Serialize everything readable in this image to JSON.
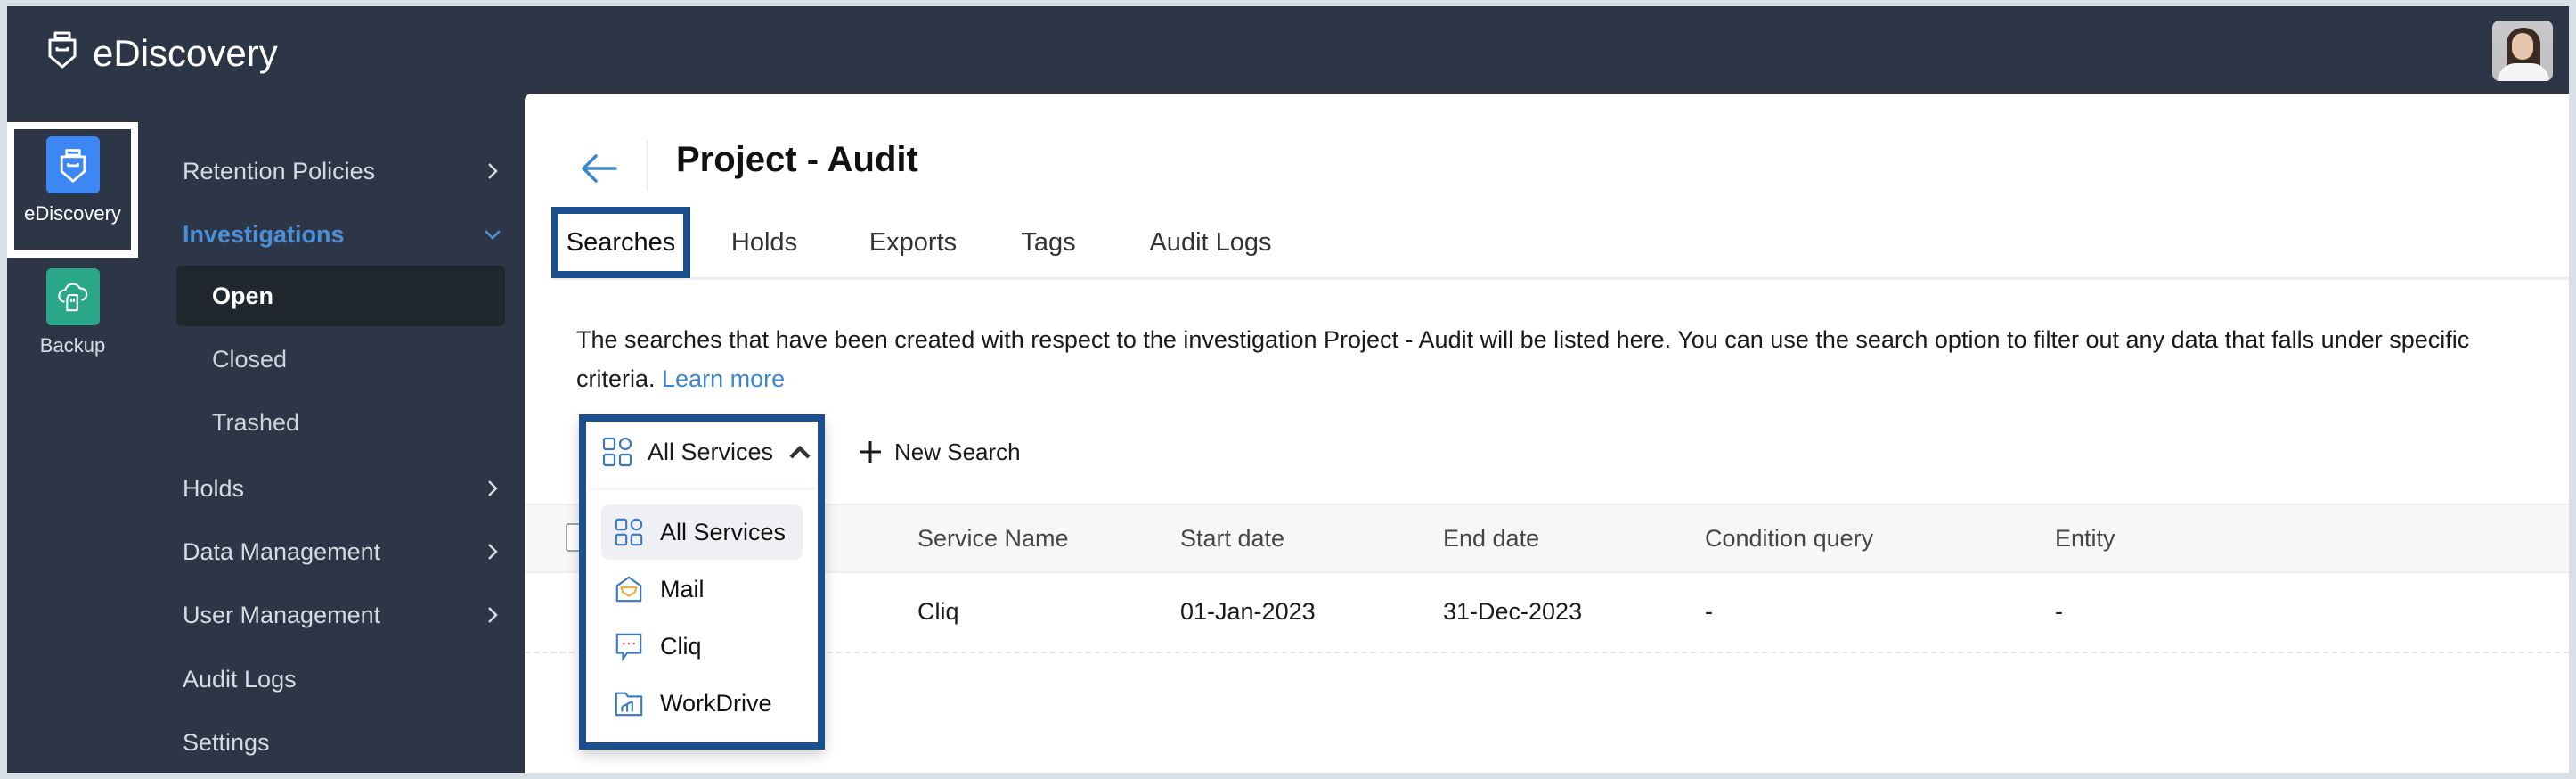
{
  "header": {
    "app_title": "eDiscovery",
    "logo_icon": "ediscovery-shield-icon",
    "avatar_alt": "user-avatar"
  },
  "app_switcher": [
    {
      "label": "eDiscovery",
      "icon": "ediscovery-shield-icon",
      "color": "#3d87f5",
      "selected": true
    },
    {
      "label": "Backup",
      "icon": "cloud-backup-icon",
      "color": "#2aa789",
      "selected": false
    }
  ],
  "nav": {
    "items": [
      {
        "label": "Retention Policies",
        "chevron": "right"
      },
      {
        "label": "Investigations",
        "chevron": "down",
        "active": true
      },
      {
        "label": "Holds",
        "chevron": "right"
      },
      {
        "label": "Data Management",
        "chevron": "right"
      },
      {
        "label": "User Management",
        "chevron": "right"
      },
      {
        "label": "Audit Logs"
      },
      {
        "label": "Settings"
      }
    ],
    "sub_items": [
      {
        "label": "Open",
        "selected": true
      },
      {
        "label": "Closed"
      },
      {
        "label": "Trashed"
      }
    ]
  },
  "page": {
    "title": "Project - Audit",
    "back_icon": "arrow-left-icon",
    "tabs": [
      {
        "label": "Searches",
        "active": true
      },
      {
        "label": "Holds"
      },
      {
        "label": "Exports"
      },
      {
        "label": "Tags"
      },
      {
        "label": "Audit Logs"
      }
    ],
    "description": "The searches that have been created with respect to the investigation Project - Audit will be listed here. You can use the search option to filter out any data that falls under specific criteria.",
    "learn_more": "Learn more"
  },
  "toolbar": {
    "service_filter": "All Services",
    "new_search": "New Search"
  },
  "dropdown": {
    "options": [
      {
        "label": "All Services",
        "icon": "grid-icon",
        "selected": true
      },
      {
        "label": "Mail",
        "icon": "mail-icon"
      },
      {
        "label": "Cliq",
        "icon": "chat-icon"
      },
      {
        "label": "WorkDrive",
        "icon": "folder-icon"
      }
    ]
  },
  "table": {
    "columns": [
      "Service Name",
      "Start date",
      "End date",
      "Condition query",
      "Entity"
    ],
    "rows": [
      [
        "Cliq",
        "01-Jan-2023",
        "31-Dec-2023",
        "-",
        "-"
      ]
    ]
  },
  "colors": {
    "header_bg": "#2d3646",
    "accent_blue": "#4a90d9",
    "highlight_border": "#1b4f8e",
    "ediscovery_tile": "#3d87f5",
    "backup_tile": "#2aa789"
  }
}
